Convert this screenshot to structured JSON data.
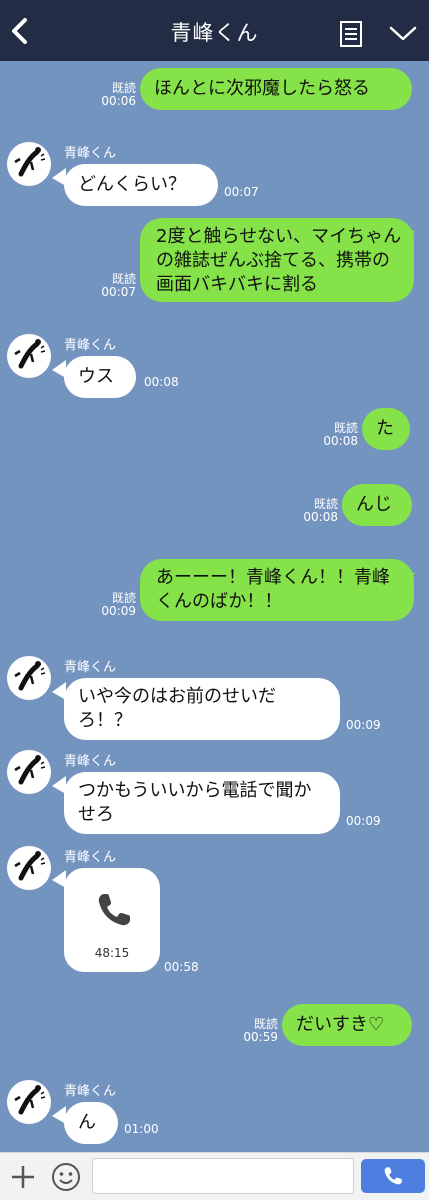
{
  "header": {
    "title": "青峰くん"
  },
  "messages": [
    {
      "side": "out",
      "read": "既読",
      "time": "00:06",
      "text": "ほんとに次邪魔したら怒る"
    },
    {
      "side": "in",
      "sender": "青峰くん",
      "time": "00:07",
      "text": "どんくらい？"
    },
    {
      "side": "out",
      "read": "既読",
      "time": "00:07",
      "text": "2度と触らせない、マイちゃんの雑誌ぜんぶ捨てる、携帯の画面バキバキに割る"
    },
    {
      "side": "in",
      "sender": "青峰くん",
      "time": "00:08",
      "text": "ウス"
    },
    {
      "side": "out",
      "read": "既読",
      "time": "00:08",
      "text": "た"
    },
    {
      "side": "out",
      "read": "既読",
      "time": "00:08",
      "text": "んじ"
    },
    {
      "side": "out",
      "read": "既読",
      "time": "00:09",
      "text": "あーーー！青峰くん！！青峰くんのばか！！"
    },
    {
      "side": "in",
      "sender": "青峰くん",
      "time": "00:09",
      "text": "いや今のはお前のせいだろ！？"
    },
    {
      "side": "in",
      "sender": "青峰くん",
      "time": "00:09",
      "text": "つかもういいから電話で聞かせろ"
    },
    {
      "side": "in",
      "sender": "青峰くん",
      "time": "00:58",
      "call_duration": "48:15"
    },
    {
      "side": "out",
      "read": "既読",
      "time": "00:59",
      "text": "だいすき♡"
    },
    {
      "side": "in",
      "sender": "青峰くん",
      "time": "01:00",
      "text": "ん"
    }
  ],
  "icons": {
    "back": "chevron-left-icon",
    "menu": "note-list-icon",
    "down": "chevron-down-icon",
    "plus": "plus-icon",
    "emoji": "smiley-icon",
    "call": "phone-icon"
  },
  "colors": {
    "background": "#7494c0",
    "header": "#232c45",
    "outgoing_bubble": "#85e249",
    "incoming_bubble": "#ffffff",
    "call_button": "#4e7fe0"
  },
  "footer": {
    "input_value": ""
  }
}
